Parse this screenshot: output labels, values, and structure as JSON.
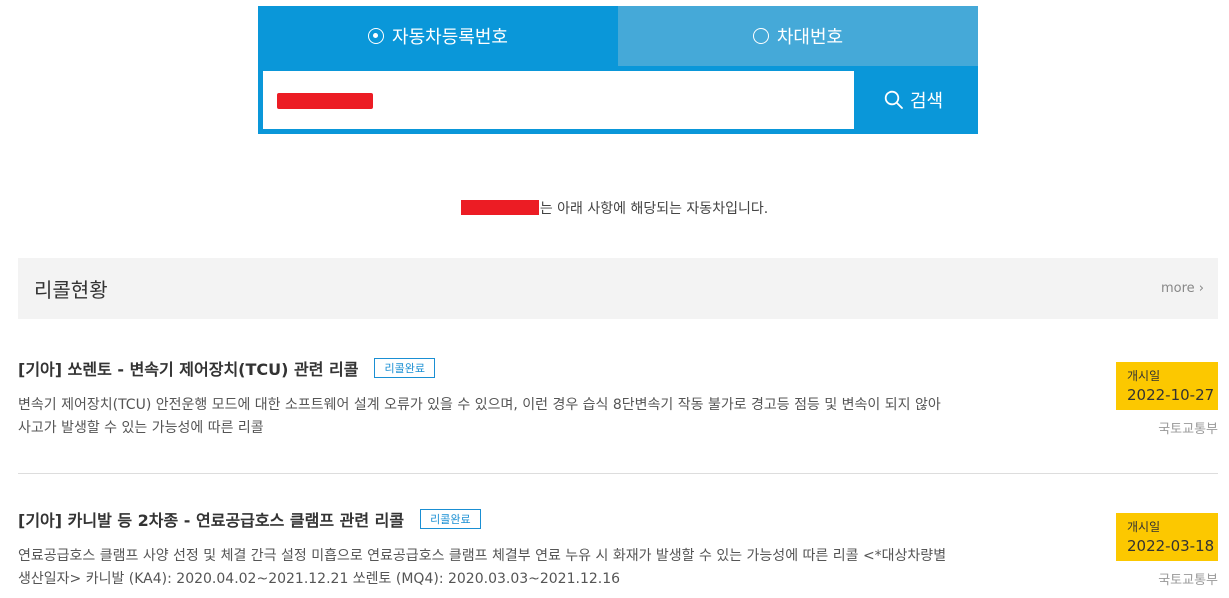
{
  "search": {
    "tabs": [
      {
        "label": "자동차등록번호",
        "selected": true
      },
      {
        "label": "차대번호",
        "selected": false
      }
    ],
    "button_label": "검색",
    "icon": "search-icon"
  },
  "result": {
    "suffix": "는 아래 사항에 해당되는 자동차입니다."
  },
  "recall": {
    "title": "리콜현황",
    "more_label": "more",
    "items": [
      {
        "title": "[기아] 쏘렌토 - 변속기 제어장치(TCU) 관련 리콜",
        "badge": "리콜완료",
        "desc_line1": "변속기 제어장치(TCU) 안전운행 모드에 대한 소프트웨어 설계 오류가 있을 수 있으며, 이런 경우 습식 8단변속기 작동 불가로 경고등 점등 및 변속이 되지 않아",
        "desc_line2": "사고가 발생할 수 있는 가능성에 따른 리콜",
        "date_label": "개시일",
        "date": "2022-10-27",
        "agency": "국토교통부"
      },
      {
        "title": "[기아] 카니발 등 2차종 - 연료공급호스 클램프 관련 리콜",
        "badge": "리콜완료",
        "desc_line1": "연료공급호스 클램프 사양 선정 및 체결 간극 설정 미흡으로 연료공급호스 클램프 체결부 연료 누유 시 화재가 발생할 수 있는 가능성에 따른 리콜  <*대상차량별",
        "desc_line2": "생산일자> 카니발 (KA4): 2020.04.02~2021.12.21 쏘렌토 (MQ4): 2020.03.03~2021.12.16",
        "date_label": "개시일",
        "date": "2022-03-18",
        "agency": "국토교통부"
      }
    ]
  },
  "colors": {
    "primary": "#0a97d9",
    "tab_inactive": "#45a9d8",
    "badge": "#1a8fd3",
    "date_box": "#fcc800",
    "redaction": "#ec1c24"
  }
}
